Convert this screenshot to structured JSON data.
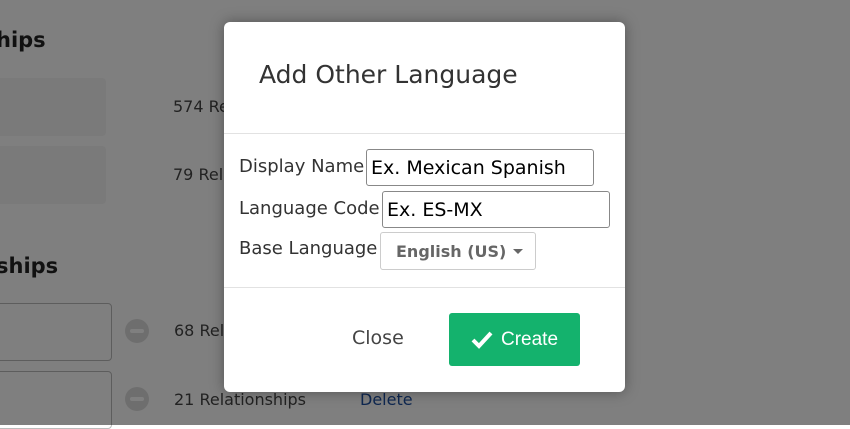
{
  "background": {
    "heading1": "hips",
    "heading2": "ships",
    "counts": [
      "574 Re",
      "79 Rel",
      "68 Rel",
      "21 Relationships"
    ],
    "delete_label": "Delete"
  },
  "modal": {
    "title": "Add Other Language",
    "fields": {
      "display_name": {
        "label": "Display Name",
        "placeholder": "Ex. Mexican Spanish"
      },
      "language_code": {
        "label": "Language Code",
        "placeholder": "Ex. ES-MX"
      },
      "base_language": {
        "label": "Base Language",
        "value": "English (US)"
      }
    },
    "close_label": "Close",
    "create_label": "Create",
    "accent": "#14b26d"
  }
}
